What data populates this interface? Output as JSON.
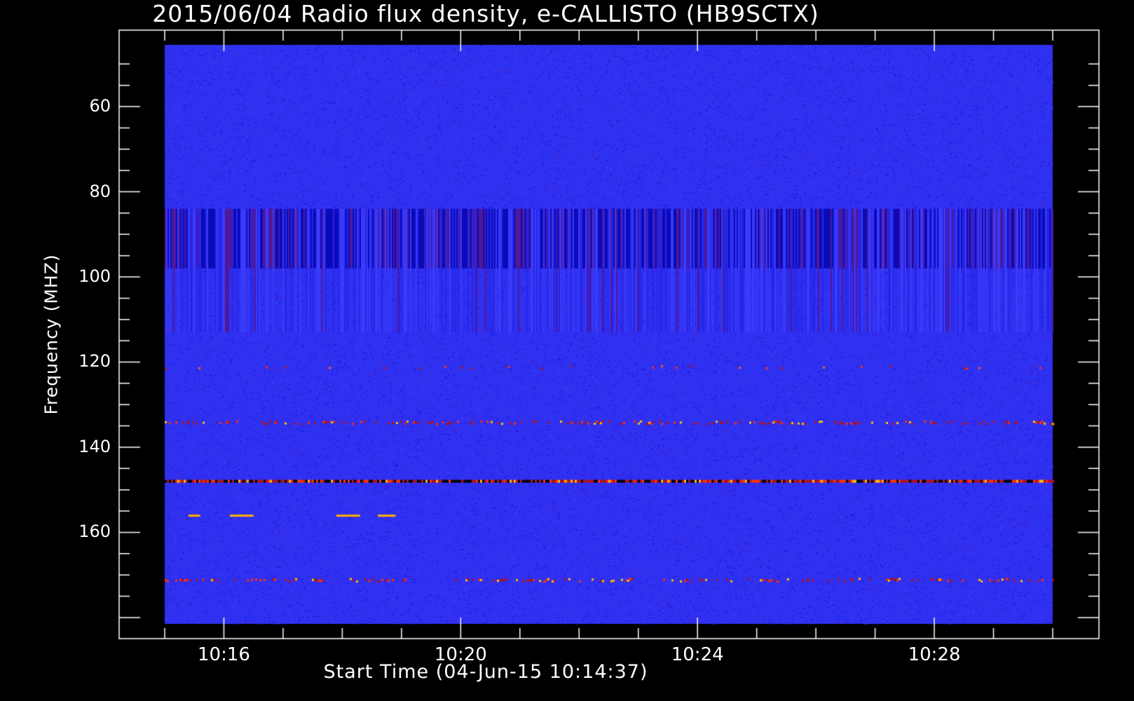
{
  "chart_data": {
    "type": "heatmap",
    "title": "2015/06/04  Radio flux density, e-CALLISTO (HB9SCTX)",
    "xlabel": "Start Time (04-Jun-15 10:14:37)",
    "ylabel": "Frequency (MHZ)",
    "x_ticks": [
      "10:16",
      "10:20",
      "10:24",
      "10:28"
    ],
    "x_tick_minutes": [
      16,
      20,
      24,
      28
    ],
    "x_range_minutes": [
      15.0,
      30.0
    ],
    "y_ticks": [
      60,
      80,
      100,
      120,
      140,
      160
    ],
    "y_range_mhz": [
      45.5,
      181.5
    ],
    "y_reversed": true,
    "colormap": [
      "#000000",
      "#1010ff",
      "#3434f0",
      "#a0102a",
      "#ff3000",
      "#ffc000"
    ],
    "background_color": "#3030f0",
    "features": [
      {
        "kind": "band-vertical-stripes",
        "freq_mhz": [
          84,
          113
        ],
        "intensity": "dark"
      },
      {
        "kind": "emission-line",
        "freq_mhz": 134,
        "intensity": "bright"
      },
      {
        "kind": "emission-line",
        "freq_mhz": 148,
        "intensity": "mixed"
      },
      {
        "kind": "emission-line",
        "freq_mhz": 156,
        "intensity": "intermittent"
      },
      {
        "kind": "emission-line",
        "freq_mhz": 171,
        "intensity": "bright"
      },
      {
        "kind": "emission-line",
        "freq_mhz": 121,
        "intensity": "sparse"
      }
    ]
  }
}
